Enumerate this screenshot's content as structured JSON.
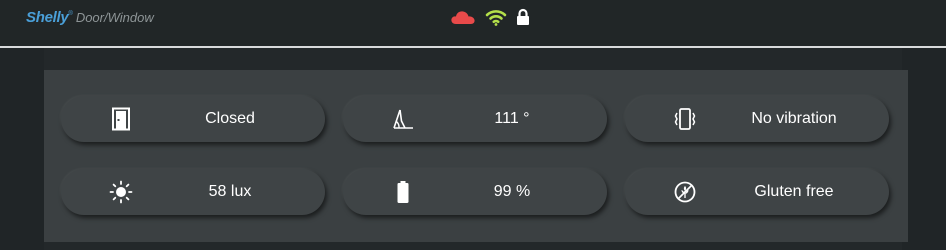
{
  "header": {
    "brand": "Shelly",
    "model": "Door/Window",
    "status_icons": [
      "cloud-icon",
      "wifi-icon",
      "lock-icon"
    ],
    "colors": {
      "brand_blue": "#4a9fd8",
      "cloud_red": "#e84a4a",
      "wifi_green": "#b4e04a"
    }
  },
  "tiles": [
    {
      "icon": "door-icon",
      "value": "Closed"
    },
    {
      "icon": "tilt-angle-icon",
      "value": "111 °"
    },
    {
      "icon": "vibration-icon",
      "value": "No vibration"
    },
    {
      "icon": "sun-icon",
      "value": "58 lux"
    },
    {
      "icon": "battery-icon",
      "value": "99 %"
    },
    {
      "icon": "gluten-free-icon",
      "value": "Gluten free"
    }
  ]
}
